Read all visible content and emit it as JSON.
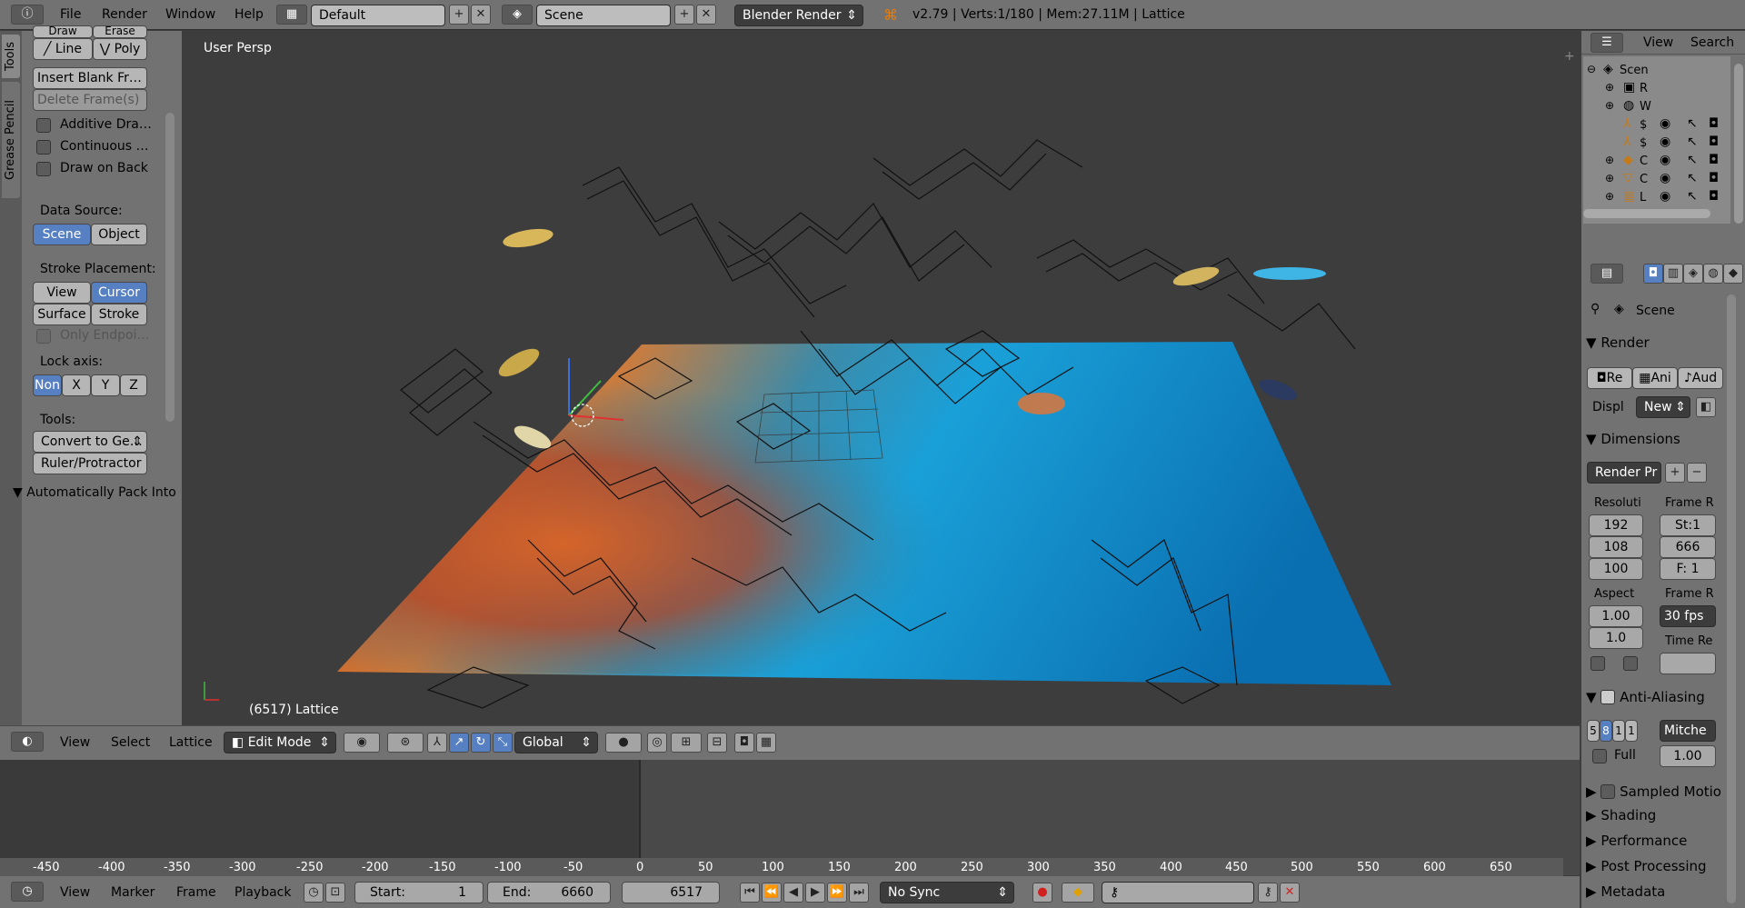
{
  "topbar": {
    "menus": [
      "File",
      "Render",
      "Window",
      "Help"
    ],
    "screen_layout": "Default",
    "scene": "Scene",
    "render_engine": "Blender Render",
    "stats": "v2.79 | Verts:1/180 | Mem:27.11M | Lattice"
  },
  "tabs": [
    "Tools",
    "Grease Pencil"
  ],
  "toolshelf": {
    "draw": "Draw",
    "erase": "Erase",
    "line": "Line",
    "poly": "Poly",
    "insert_blank": "Insert Blank Fr…",
    "delete_frames": "Delete Frame(s)",
    "additive": "Additive Dra…",
    "continuous": "Continuous …",
    "draw_on_back": "Draw on Back",
    "data_source_label": "Data Source:",
    "ds_scene": "Scene",
    "ds_object": "Object",
    "stroke_placement_label": "Stroke Placement:",
    "sp_view": "View",
    "sp_cursor": "Cursor",
    "sp_surface": "Surface",
    "sp_stroke": "Stroke",
    "only_endpoints": "Only Endpoi…",
    "lock_axis_label": "Lock axis:",
    "la_none": "Non",
    "la_x": "X",
    "la_y": "Y",
    "la_z": "Z",
    "tools_label": "Tools:",
    "convert": "Convert to Ge…",
    "ruler": "Ruler/Protractor",
    "auto_pack": "Automatically Pack Into"
  },
  "viewport": {
    "view_name": "User Persp",
    "object_info": "(6517) Lattice"
  },
  "outliner": {
    "view": "View",
    "search": "Search",
    "rows": [
      {
        "label": "Scen"
      },
      {
        "label": "R"
      },
      {
        "label": "W"
      },
      {
        "label": "$"
      },
      {
        "label": "$"
      },
      {
        "label": "C"
      },
      {
        "label": "C"
      },
      {
        "label": "L"
      }
    ]
  },
  "properties": {
    "context": "Scene",
    "render": "Render",
    "render_btn": "Re",
    "anim_btn": "Ani",
    "audio_btn": "Aud",
    "display_label": "Displ",
    "display_value": "New",
    "dimensions": "Dimensions",
    "render_presets": "Render Pr",
    "resolution": "Resoluti",
    "res_x": "192",
    "res_y": "108",
    "res_pct": "100",
    "frame_range": "Frame R",
    "start": "St:1",
    "end": "666",
    "step": "F: 1",
    "aspect": "Aspect",
    "asp_x": "1.00",
    "asp_y": "1.0",
    "frame_rate": "Frame R",
    "fps": "30 fps",
    "time_remap": "Time Re",
    "anti_aliasing": "Anti-Aliasing",
    "aa_samples": [
      "5",
      "8",
      "1",
      "1"
    ],
    "filter": "Mitche",
    "full": "Full",
    "filter_size": "1.00",
    "sampled_motion": "Sampled Motio",
    "shading": "Shading",
    "performance": "Performance",
    "post_processing": "Post Processing",
    "metadata": "Metadata"
  },
  "vp_header": {
    "view": "View",
    "select": "Select",
    "lattice": "Lattice",
    "mode": "Edit Mode",
    "orientation": "Global"
  },
  "ruler_ticks": [
    "-450",
    "-400",
    "-350",
    "-300",
    "-250",
    "-200",
    "-150",
    "-100",
    "-50",
    "0",
    "50",
    "100",
    "150",
    "200",
    "250",
    "300",
    "350",
    "400",
    "450",
    "500",
    "550",
    "600",
    "650"
  ],
  "tl_header": {
    "view": "View",
    "marker": "Marker",
    "frame": "Frame",
    "playback": "Playback",
    "start_label": "Start:",
    "start_value": "1",
    "end_label": "End:",
    "end_value": "6660",
    "current": "6517",
    "sync": "No Sync"
  }
}
